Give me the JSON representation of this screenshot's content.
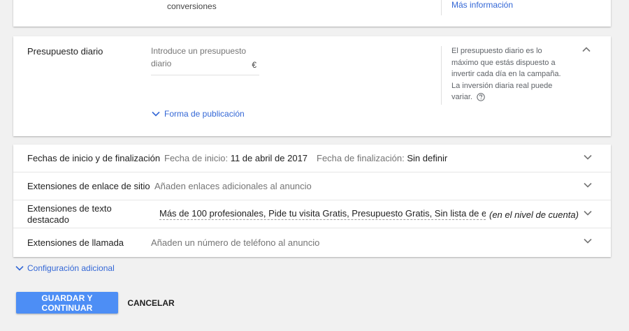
{
  "top_card": {
    "conversions_text": "conversiones",
    "more_info_link": "Más información"
  },
  "budget": {
    "label": "Presupuesto diario",
    "input_placeholder": "Introduce un presupuesto diario",
    "currency": "€",
    "delivery_link": "Forma de publicación",
    "help_text": "El presupuesto diario es lo máximo que estás dispuesto a invertir cada día en la campaña. La inversión diaria real puede variar."
  },
  "rows": [
    {
      "label": "Fechas de inicio y de finalización",
      "start_prefix": "Fecha de inicio:",
      "start_value": "11 de abril de 2017",
      "end_prefix": "Fecha de finalización:",
      "end_value": "Sin definir"
    },
    {
      "label": "Extensiones de enlace de sitio",
      "value": "Añaden enlaces adicionales al anuncio"
    },
    {
      "label": "Extensiones de texto destacado",
      "value": "Más de 100 profesionales, Pide tu visita Gratis, Presupuesto Gratis, Sin lista de es...",
      "suffix": "(en el nivel de cuenta)"
    },
    {
      "label": "Extensiones de llamada",
      "value": "Añaden un número de teléfono al anuncio"
    }
  ],
  "additional_config_link": "Configuración adicional",
  "buttons": {
    "save": "GUARDAR Y CONTINUAR",
    "cancel": "CANCELAR"
  },
  "colors": {
    "link": "#3367d6",
    "primary_button": "#4d8ef5",
    "background": "#f1f1f1"
  },
  "icons": [
    "chevron-down-icon",
    "chevron-up-icon",
    "help-circle-icon"
  ]
}
